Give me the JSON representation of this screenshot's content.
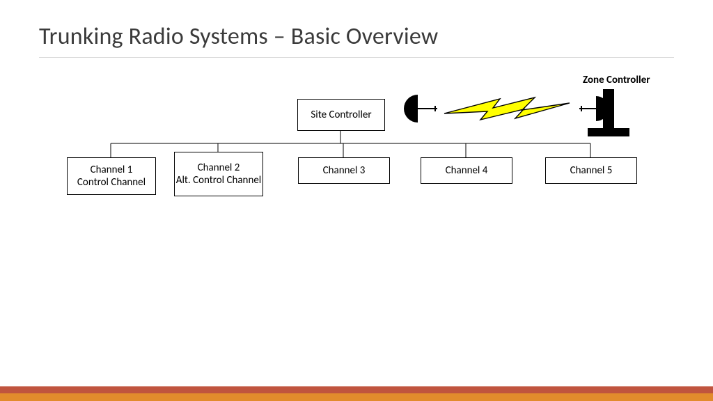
{
  "slide": {
    "title": "Trunking Radio Systems – Basic Overview"
  },
  "diagram": {
    "zone_controller_label": "Zone Controller",
    "site_controller_label": "Site Controller",
    "channels": [
      {
        "name": "Channel 1",
        "subtitle": "Control Channel"
      },
      {
        "name": "Channel 2",
        "subtitle": "Alt. Control Channel"
      },
      {
        "name": "Channel 3",
        "subtitle": ""
      },
      {
        "name": "Channel 4",
        "subtitle": ""
      },
      {
        "name": "Channel 5",
        "subtitle": ""
      }
    ]
  }
}
